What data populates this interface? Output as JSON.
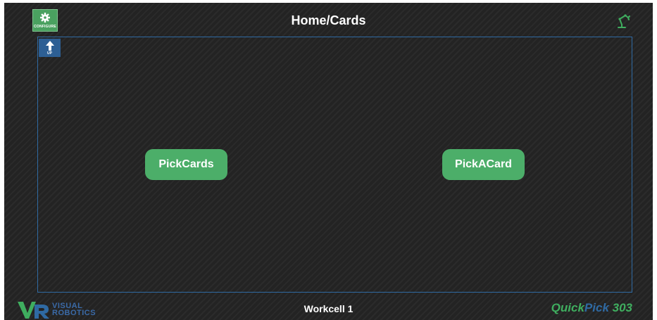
{
  "header": {
    "title": "Home/Cards",
    "configure_label": "CONFIGURE"
  },
  "workspace": {
    "up_label": "UP",
    "buttons": [
      {
        "label": "PickCards"
      },
      {
        "label": "PickACard"
      }
    ]
  },
  "footer": {
    "logo_line1": "VISUAL",
    "logo_line2": "ROBOTICS",
    "workcell": "Workcell 1",
    "brand_quick": "Quick",
    "brand_pick": "Pick",
    "brand_model": " 303"
  },
  "colors": {
    "background": "#232323",
    "accent_green": "#4cae69",
    "accent_blue": "#2f6aa3"
  },
  "icons": [
    "gear-icon",
    "robot-arm-icon",
    "up-arrow-icon",
    "vr-logo"
  ]
}
